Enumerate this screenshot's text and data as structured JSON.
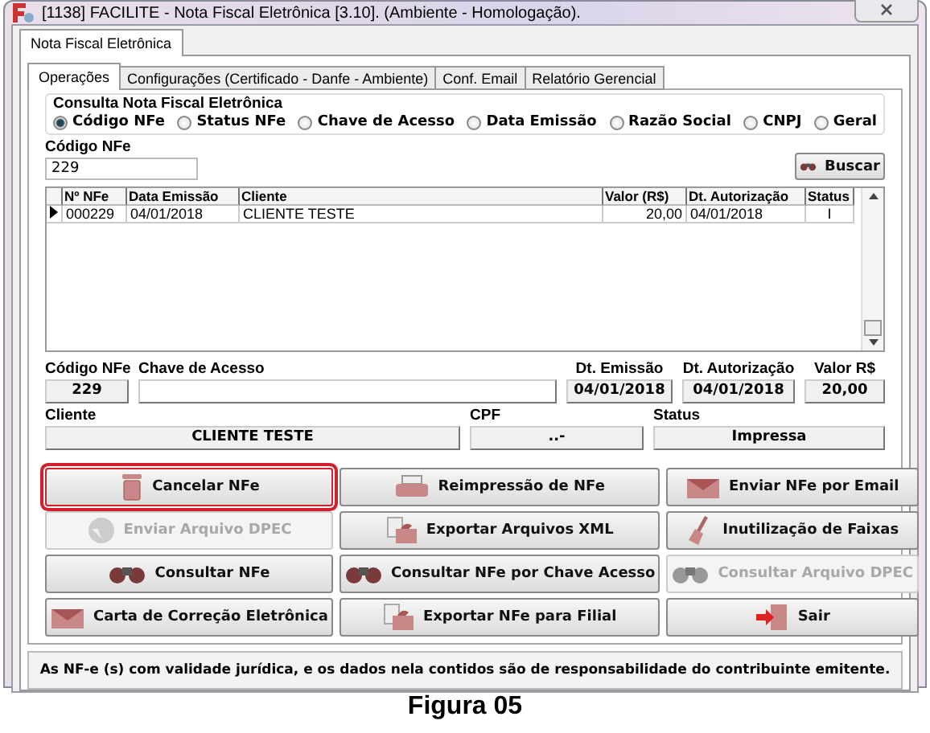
{
  "window": {
    "title": "[1138] FACILITE - Nota Fiscal Eletrônica [3.10]. (Ambiente - Homologação)."
  },
  "outer_tabs": [
    {
      "label": "Nota Fiscal Eletrônica",
      "selected": true
    }
  ],
  "inner_tabs": [
    {
      "label": "Operações",
      "selected": true
    },
    {
      "label": "Configurações (Certificado - Danfe - Ambiente)",
      "selected": false
    },
    {
      "label": "Conf. Email",
      "selected": false
    },
    {
      "label": "Relatório Gerencial",
      "selected": false
    }
  ],
  "search_group": {
    "title": "Consulta Nota Fiscal Eletrônica",
    "options": [
      {
        "label": "Código NFe",
        "selected": true
      },
      {
        "label": "Status NFe",
        "selected": false
      },
      {
        "label": "Chave de Acesso",
        "selected": false
      },
      {
        "label": "Data Emissão",
        "selected": false
      },
      {
        "label": "Razão Social",
        "selected": false
      },
      {
        "label": "CNPJ",
        "selected": false
      },
      {
        "label": "Geral",
        "selected": false
      }
    ]
  },
  "code_field": {
    "label": "Código NFe",
    "value": "229"
  },
  "search_button": "Buscar",
  "table": {
    "columns": [
      "Nº NFe",
      "Data Emissão",
      "Cliente",
      "Valor (R$)",
      "Dt. Autorização",
      "Status"
    ],
    "rows": [
      {
        "selected": true,
        "cells": [
          "000229",
          "04/01/2018",
          "CLIENTE TESTE",
          "20,00",
          "04/01/2018",
          "I"
        ]
      }
    ]
  },
  "details": [
    {
      "label": "Código NFe",
      "value": "229"
    },
    {
      "label": "Chave de Acesso"
    },
    {
      "label": "Dt. Emissão",
      "value": "04/01/2018"
    },
    {
      "label": "Dt. Autorização",
      "value": "04/01/2018"
    },
    {
      "label": "Valor R$",
      "value": "20,00"
    }
  ],
  "details2": [
    {
      "label": "Cliente",
      "value": "CLIENTE TESTE"
    },
    {
      "label": "CPF",
      "value": "..-"
    },
    {
      "label": "Status",
      "value": "Impressa"
    }
  ],
  "buttons": [
    {
      "label": "Cancelar NFe",
      "disabled": false,
      "highlighted": true
    },
    {
      "label": "Reimpressão de NFe",
      "disabled": false,
      "highlighted": false
    },
    {
      "label": "Enviar NFe por Email",
      "disabled": false,
      "highlighted": false
    },
    {
      "label": "Enviar Arquivo DPEC",
      "disabled": true,
      "highlighted": false
    },
    {
      "label": "Exportar Arquivos XML",
      "disabled": false,
      "highlighted": false
    },
    {
      "label": "Inutilização de Faixas",
      "disabled": false,
      "highlighted": false
    },
    {
      "label": "Consultar NFe",
      "disabled": false,
      "highlighted": false
    },
    {
      "label": "Consultar NFe por Chave Acesso",
      "disabled": false,
      "highlighted": false
    },
    {
      "label": "Consultar Arquivo DPEC",
      "disabled": true,
      "highlighted": false
    },
    {
      "label": "Carta de Correção Eletrônica",
      "disabled": false,
      "highlighted": false
    },
    {
      "label": "Exportar NFe para Filial",
      "disabled": false,
      "highlighted": false
    },
    {
      "label": "Sair",
      "disabled": false,
      "highlighted": false
    }
  ],
  "status_bar": "As NF-e (s) com validade jurídica, e os dados nela contidos são de responsabilidade do contribuinte emitente.",
  "caption": "Figura 05"
}
